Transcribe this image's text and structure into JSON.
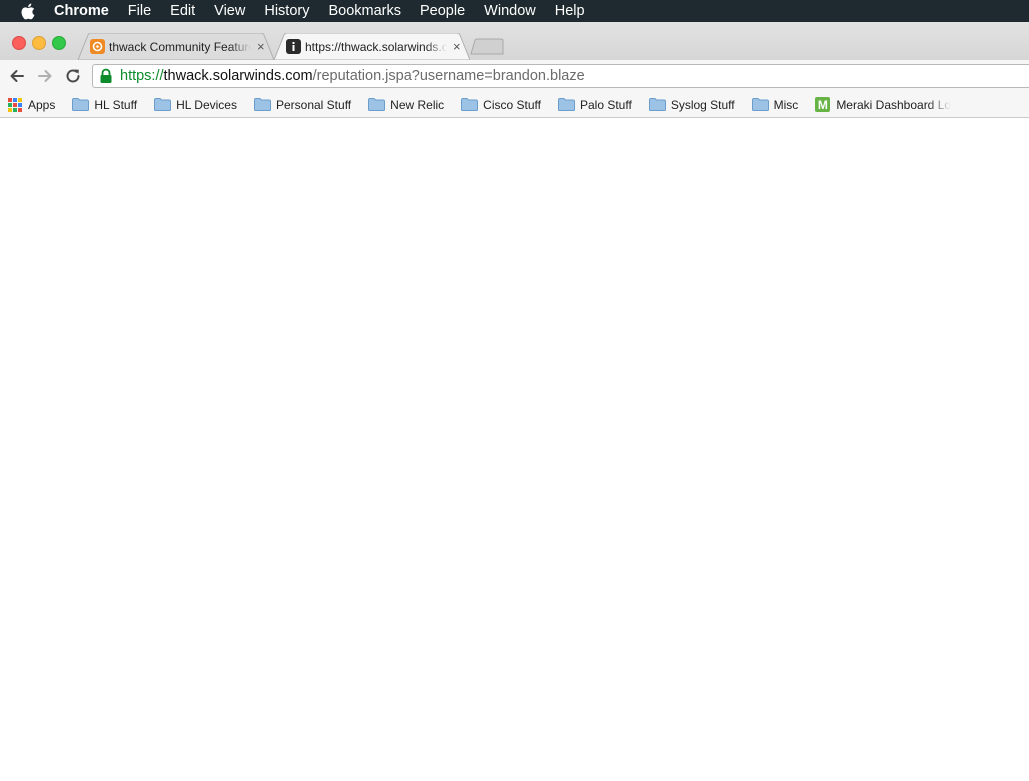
{
  "menubar": {
    "items": [
      "Chrome",
      "File",
      "Edit",
      "View",
      "History",
      "Bookmarks",
      "People",
      "Window",
      "Help"
    ]
  },
  "tabs": [
    {
      "title": "thwack Community Feature",
      "close": "×"
    },
    {
      "title": "https://thwack.solarwinds.com/reputation.jspa?username=brandon.blaze",
      "close": "×"
    }
  ],
  "omnibox": {
    "scheme": "https://",
    "host": "thwack.solarwinds.com",
    "path": "/reputation.jspa?username=brandon.blaze"
  },
  "bookmarks": {
    "apps_label": "Apps",
    "folders": [
      "HL Stuff",
      "HL Devices",
      "Personal Stuff",
      "New Relic",
      "Cisco Stuff",
      "Palo Stuff",
      "Syslog Stuff",
      "Misc"
    ],
    "meraki": {
      "icon_letter": "M",
      "label": "Meraki Dashboard Login"
    }
  },
  "colors": {
    "menubar_bg": "#1e2a2f",
    "secure_scheme": "#0b8b2b",
    "meraki_green": "#67b346"
  },
  "icons": {
    "apple": "apple-logo-icon",
    "back": "back-arrow-icon",
    "forward": "forward-arrow-icon",
    "reload": "reload-icon",
    "lock": "lock-icon",
    "folder": "folder-icon"
  }
}
